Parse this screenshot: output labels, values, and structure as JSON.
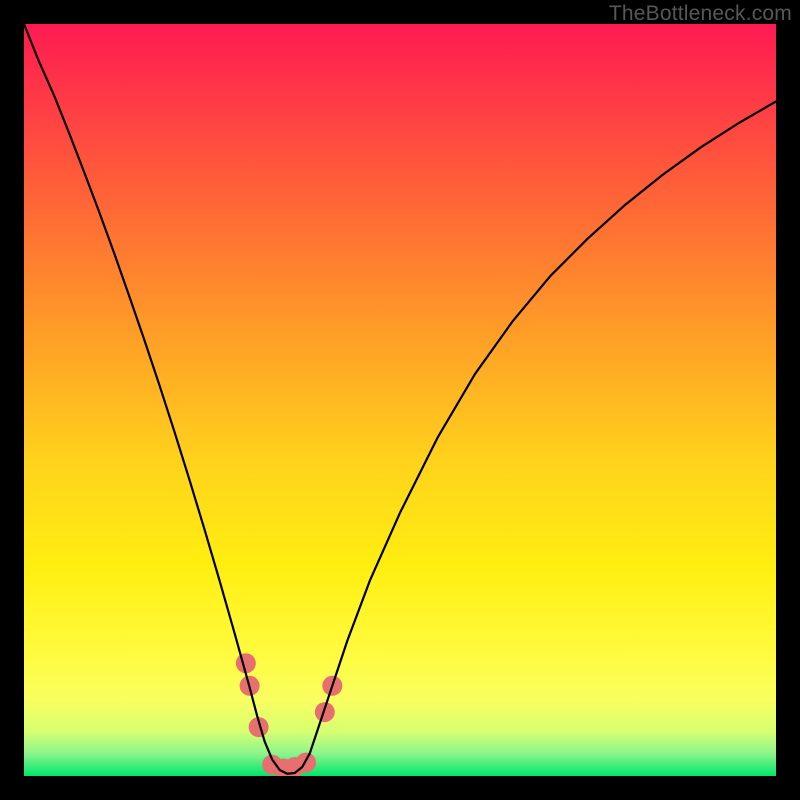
{
  "watermark": "TheBottleneck.com",
  "chart_data": {
    "type": "line",
    "title": "",
    "xlabel": "",
    "ylabel": "",
    "xlim": [
      0,
      100
    ],
    "ylim": [
      0,
      100
    ],
    "grid": false,
    "legend": false,
    "background_gradient": {
      "top": "#ff1a52",
      "upper_mid": "#ff7a2b",
      "mid": "#ffe500",
      "lower": "#ffff62",
      "bottom": "#00e56a"
    },
    "series": [
      {
        "name": "curve",
        "x": [
          0,
          2,
          4,
          6,
          8,
          10,
          12,
          14,
          16,
          18,
          20,
          22,
          24,
          26,
          28,
          30,
          31,
          32,
          33,
          34,
          35,
          36,
          37,
          38,
          39,
          41,
          43,
          46,
          50,
          55,
          60,
          65,
          70,
          75,
          80,
          85,
          90,
          95,
          100
        ],
        "y": [
          100,
          95,
          90.5,
          85.5,
          80.3,
          75,
          69.5,
          63.8,
          58,
          52,
          45.8,
          39.4,
          32.8,
          26,
          19,
          11.8,
          8,
          4.6,
          2.2,
          0.8,
          0.3,
          0.4,
          1.2,
          3,
          6,
          12,
          18,
          26,
          35,
          45,
          53.5,
          60.5,
          66.5,
          71.5,
          76,
          80,
          83.6,
          86.8,
          89.7
        ],
        "color": "#000000"
      },
      {
        "name": "markers",
        "points": [
          {
            "x": 29.5,
            "y": 15.0
          },
          {
            "x": 30.0,
            "y": 12.0
          },
          {
            "x": 31.2,
            "y": 6.5
          },
          {
            "x": 33.0,
            "y": 1.5
          },
          {
            "x": 34.5,
            "y": 1.0
          },
          {
            "x": 36.0,
            "y": 1.2
          },
          {
            "x": 37.5,
            "y": 1.8
          },
          {
            "x": 40.0,
            "y": 8.5
          },
          {
            "x": 41.0,
            "y": 12.0
          }
        ],
        "color": "#e86f6f",
        "radius": 10
      }
    ],
    "annotations": []
  }
}
